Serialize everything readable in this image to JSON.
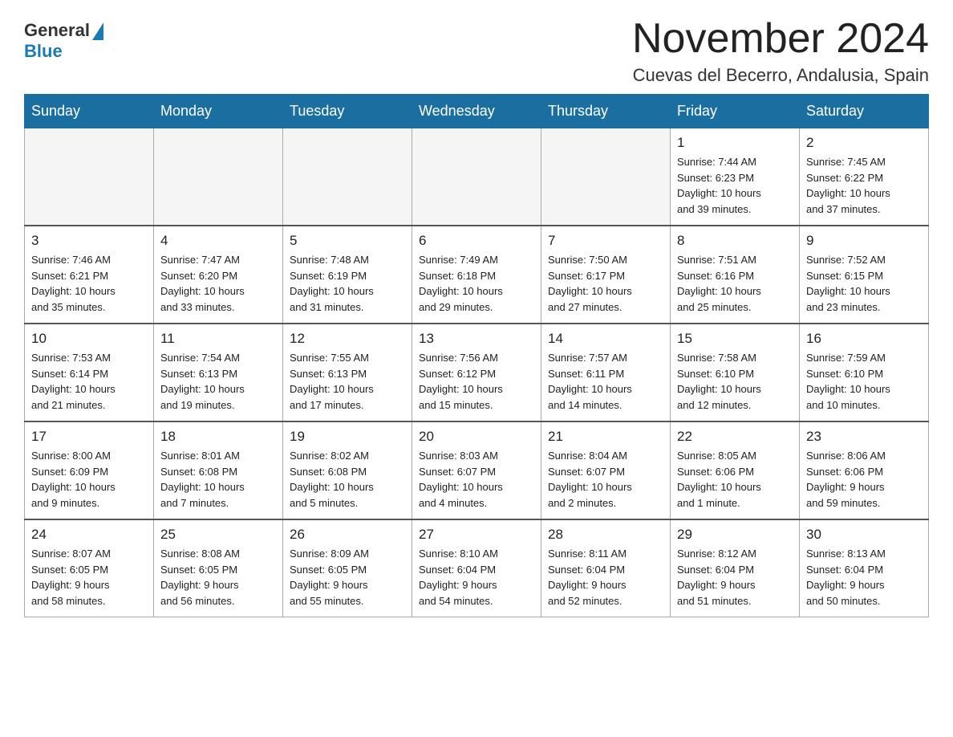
{
  "header": {
    "logo_general": "General",
    "logo_blue": "Blue",
    "month_year": "November 2024",
    "location": "Cuevas del Becerro, Andalusia, Spain"
  },
  "weekdays": [
    "Sunday",
    "Monday",
    "Tuesday",
    "Wednesday",
    "Thursday",
    "Friday",
    "Saturday"
  ],
  "weeks": [
    [
      {
        "day": "",
        "info": ""
      },
      {
        "day": "",
        "info": ""
      },
      {
        "day": "",
        "info": ""
      },
      {
        "day": "",
        "info": ""
      },
      {
        "day": "",
        "info": ""
      },
      {
        "day": "1",
        "info": "Sunrise: 7:44 AM\nSunset: 6:23 PM\nDaylight: 10 hours\nand 39 minutes."
      },
      {
        "day": "2",
        "info": "Sunrise: 7:45 AM\nSunset: 6:22 PM\nDaylight: 10 hours\nand 37 minutes."
      }
    ],
    [
      {
        "day": "3",
        "info": "Sunrise: 7:46 AM\nSunset: 6:21 PM\nDaylight: 10 hours\nand 35 minutes."
      },
      {
        "day": "4",
        "info": "Sunrise: 7:47 AM\nSunset: 6:20 PM\nDaylight: 10 hours\nand 33 minutes."
      },
      {
        "day": "5",
        "info": "Sunrise: 7:48 AM\nSunset: 6:19 PM\nDaylight: 10 hours\nand 31 minutes."
      },
      {
        "day": "6",
        "info": "Sunrise: 7:49 AM\nSunset: 6:18 PM\nDaylight: 10 hours\nand 29 minutes."
      },
      {
        "day": "7",
        "info": "Sunrise: 7:50 AM\nSunset: 6:17 PM\nDaylight: 10 hours\nand 27 minutes."
      },
      {
        "day": "8",
        "info": "Sunrise: 7:51 AM\nSunset: 6:16 PM\nDaylight: 10 hours\nand 25 minutes."
      },
      {
        "day": "9",
        "info": "Sunrise: 7:52 AM\nSunset: 6:15 PM\nDaylight: 10 hours\nand 23 minutes."
      }
    ],
    [
      {
        "day": "10",
        "info": "Sunrise: 7:53 AM\nSunset: 6:14 PM\nDaylight: 10 hours\nand 21 minutes."
      },
      {
        "day": "11",
        "info": "Sunrise: 7:54 AM\nSunset: 6:13 PM\nDaylight: 10 hours\nand 19 minutes."
      },
      {
        "day": "12",
        "info": "Sunrise: 7:55 AM\nSunset: 6:13 PM\nDaylight: 10 hours\nand 17 minutes."
      },
      {
        "day": "13",
        "info": "Sunrise: 7:56 AM\nSunset: 6:12 PM\nDaylight: 10 hours\nand 15 minutes."
      },
      {
        "day": "14",
        "info": "Sunrise: 7:57 AM\nSunset: 6:11 PM\nDaylight: 10 hours\nand 14 minutes."
      },
      {
        "day": "15",
        "info": "Sunrise: 7:58 AM\nSunset: 6:10 PM\nDaylight: 10 hours\nand 12 minutes."
      },
      {
        "day": "16",
        "info": "Sunrise: 7:59 AM\nSunset: 6:10 PM\nDaylight: 10 hours\nand 10 minutes."
      }
    ],
    [
      {
        "day": "17",
        "info": "Sunrise: 8:00 AM\nSunset: 6:09 PM\nDaylight: 10 hours\nand 9 minutes."
      },
      {
        "day": "18",
        "info": "Sunrise: 8:01 AM\nSunset: 6:08 PM\nDaylight: 10 hours\nand 7 minutes."
      },
      {
        "day": "19",
        "info": "Sunrise: 8:02 AM\nSunset: 6:08 PM\nDaylight: 10 hours\nand 5 minutes."
      },
      {
        "day": "20",
        "info": "Sunrise: 8:03 AM\nSunset: 6:07 PM\nDaylight: 10 hours\nand 4 minutes."
      },
      {
        "day": "21",
        "info": "Sunrise: 8:04 AM\nSunset: 6:07 PM\nDaylight: 10 hours\nand 2 minutes."
      },
      {
        "day": "22",
        "info": "Sunrise: 8:05 AM\nSunset: 6:06 PM\nDaylight: 10 hours\nand 1 minute."
      },
      {
        "day": "23",
        "info": "Sunrise: 8:06 AM\nSunset: 6:06 PM\nDaylight: 9 hours\nand 59 minutes."
      }
    ],
    [
      {
        "day": "24",
        "info": "Sunrise: 8:07 AM\nSunset: 6:05 PM\nDaylight: 9 hours\nand 58 minutes."
      },
      {
        "day": "25",
        "info": "Sunrise: 8:08 AM\nSunset: 6:05 PM\nDaylight: 9 hours\nand 56 minutes."
      },
      {
        "day": "26",
        "info": "Sunrise: 8:09 AM\nSunset: 6:05 PM\nDaylight: 9 hours\nand 55 minutes."
      },
      {
        "day": "27",
        "info": "Sunrise: 8:10 AM\nSunset: 6:04 PM\nDaylight: 9 hours\nand 54 minutes."
      },
      {
        "day": "28",
        "info": "Sunrise: 8:11 AM\nSunset: 6:04 PM\nDaylight: 9 hours\nand 52 minutes."
      },
      {
        "day": "29",
        "info": "Sunrise: 8:12 AM\nSunset: 6:04 PM\nDaylight: 9 hours\nand 51 minutes."
      },
      {
        "day": "30",
        "info": "Sunrise: 8:13 AM\nSunset: 6:04 PM\nDaylight: 9 hours\nand 50 minutes."
      }
    ]
  ]
}
